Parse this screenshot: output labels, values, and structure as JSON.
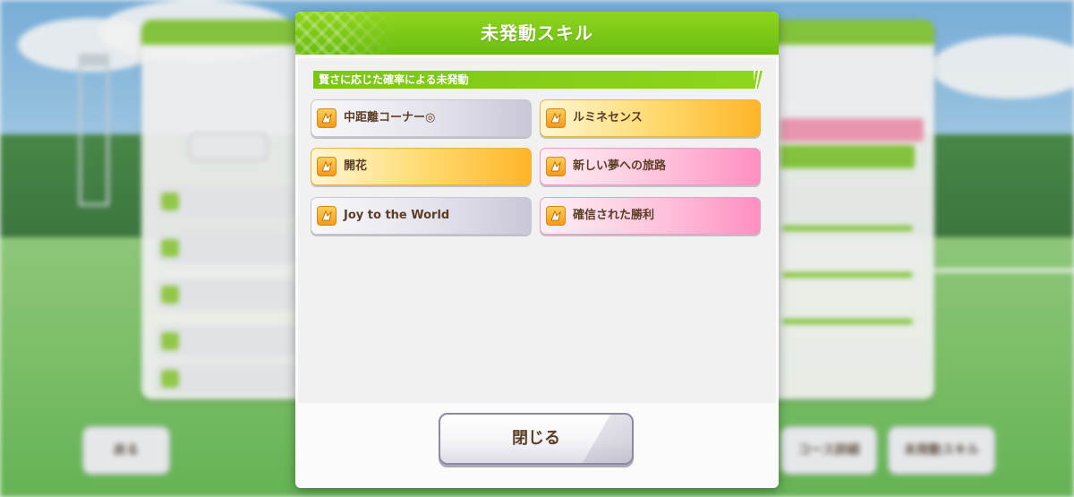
{
  "dialog": {
    "title": "未発動スキル",
    "section_label": "賢さに応じた確率による未発動",
    "skills": [
      {
        "name": "中距離コーナー◎",
        "style": "gray"
      },
      {
        "name": "ルミネセンス",
        "style": "gold"
      },
      {
        "name": "開花",
        "style": "gold"
      },
      {
        "name": "新しい夢への旅路",
        "style": "pink"
      },
      {
        "name": "Joy to the World",
        "style": "gray"
      },
      {
        "name": "確信された勝利",
        "style": "pink"
      }
    ],
    "close_label": "閉じる"
  },
  "background": {
    "back_button": "戻る",
    "course_button": "コース詳細",
    "unactivated_button": "未発動スキル"
  },
  "colors": {
    "header_green": "#7cc614",
    "text_brown": "#5c3d26",
    "gold_skill": "#ffb529",
    "pink_skill": "#ff8fc0",
    "gray_skill": "#c9c7d8"
  },
  "icons": {
    "skill_icon": "skill-rune-icon"
  }
}
